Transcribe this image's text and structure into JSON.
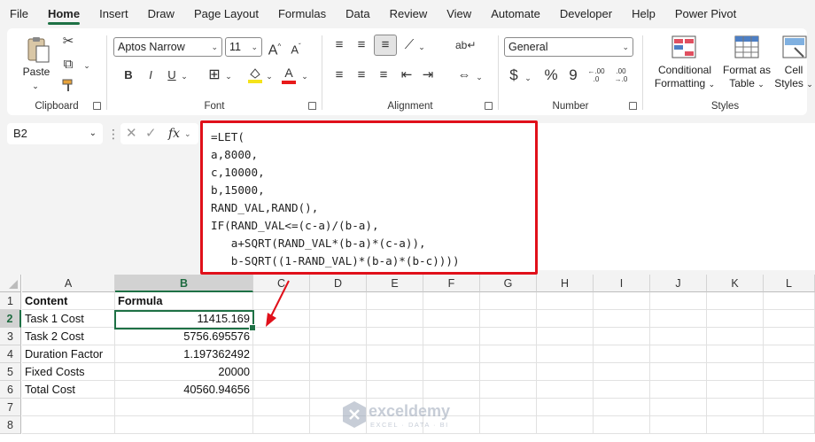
{
  "menu": {
    "tabs": [
      "File",
      "Home",
      "Insert",
      "Draw",
      "Page Layout",
      "Formulas",
      "Data",
      "Review",
      "View",
      "Automate",
      "Developer",
      "Help",
      "Power Pivot"
    ],
    "active_tab": "Home"
  },
  "ribbon": {
    "clipboard": {
      "label": "Clipboard",
      "paste": "Paste"
    },
    "font": {
      "label": "Font",
      "font_name": "Aptos Narrow",
      "font_size": "11",
      "bold": "B",
      "italic": "I",
      "underline": "U",
      "grow": "A",
      "shrink": "A",
      "font_color": "A"
    },
    "alignment": {
      "label": "Alignment"
    },
    "number": {
      "label": "Number",
      "format": "General",
      "currency": "$",
      "percent": "%",
      "comma": "9",
      "inc_decimal": "←.00 .0",
      "dec_decimal": ".00 →.0"
    },
    "styles": {
      "label": "Styles",
      "conditional": [
        "Conditional",
        "Formatting"
      ],
      "format_table": [
        "Format as",
        "Table"
      ],
      "cell_styles": [
        "Cell",
        "Styles"
      ]
    }
  },
  "formula_bar": {
    "name_box": "B2",
    "fx": "fx",
    "lines": [
      "=LET(",
      "a,8000,",
      "c,10000,",
      "b,15000,",
      "RAND_VAL,RAND(),",
      "IF(RAND_VAL<=(c-a)/(b-a),",
      "   a+SQRT(RAND_VAL*(b-a)*(c-a)),",
      "   b-SQRT((1-RAND_VAL)*(b-a)*(b-c))))"
    ]
  },
  "sheet": {
    "columns": [
      "A",
      "B",
      "C",
      "D",
      "E",
      "F",
      "G",
      "H",
      "I",
      "J",
      "K",
      "L"
    ],
    "rows": [
      "1",
      "2",
      "3",
      "4",
      "5",
      "6",
      "7",
      "8"
    ],
    "selected_column": "B",
    "selected_row": "2",
    "headers": {
      "a": "Content",
      "b": "Formula"
    },
    "data": [
      {
        "a": "Task 1 Cost",
        "b": "11415.169"
      },
      {
        "a": "Task 2 Cost",
        "b": "5756.695576"
      },
      {
        "a": "Duration Factor",
        "b": "1.197362492"
      },
      {
        "a": "Fixed Costs",
        "b": "20000"
      },
      {
        "a": "Total Cost",
        "b": "40560.94656"
      }
    ]
  },
  "watermark": {
    "name": "exceldemy",
    "sub": "EXCEL · DATA · BI"
  },
  "colors": {
    "accent": "#1e7145",
    "highlight_border": "#e0101a"
  }
}
